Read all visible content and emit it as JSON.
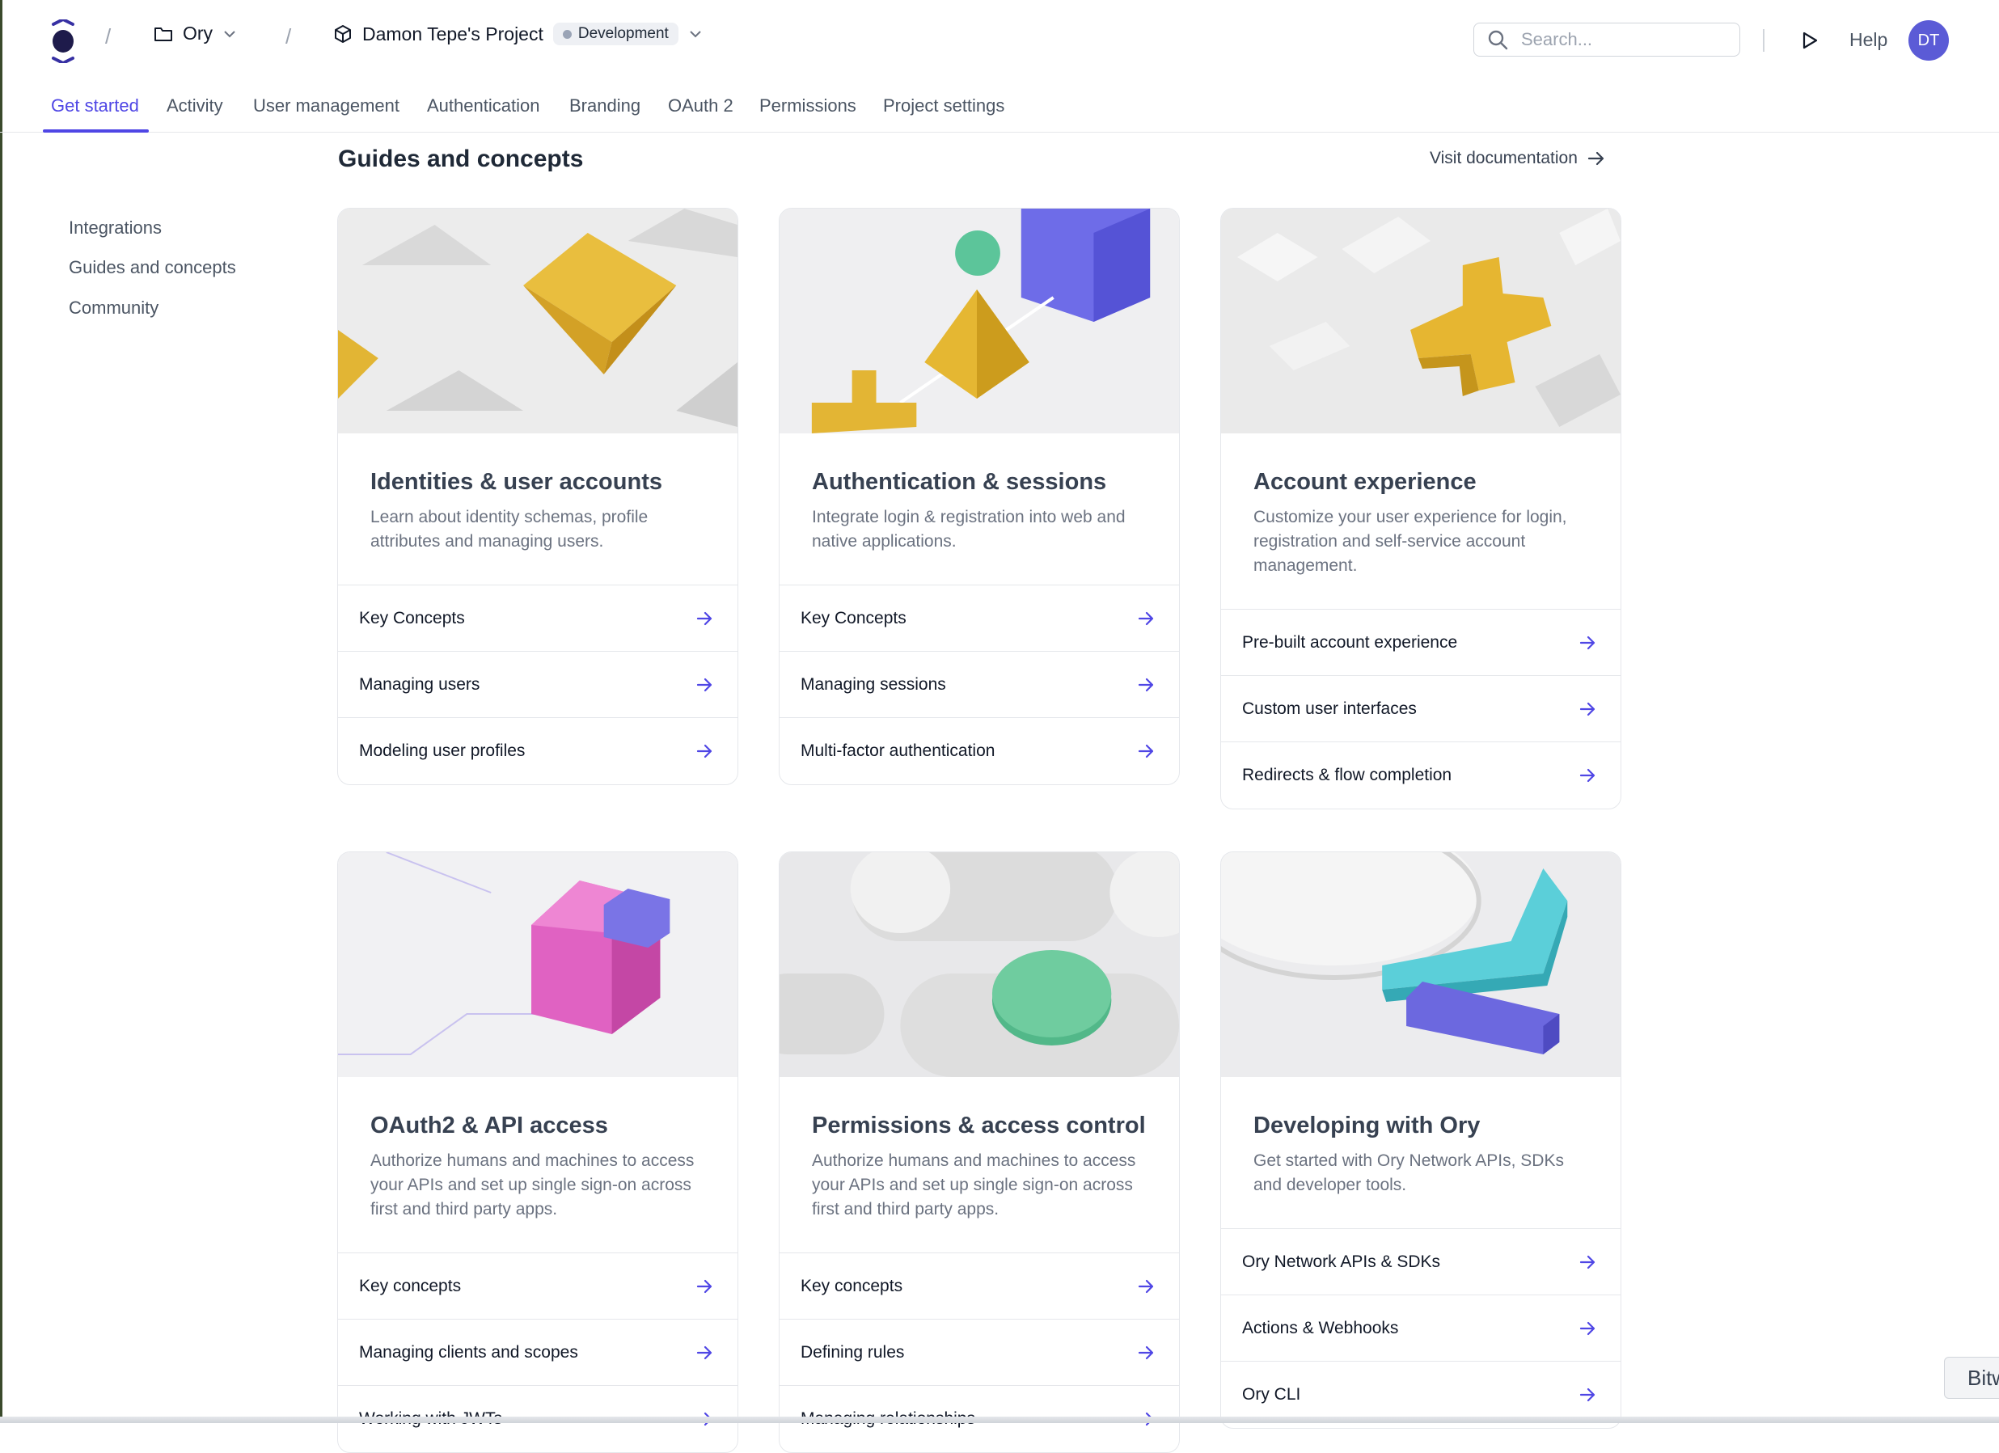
{
  "header": {
    "org_name": "Ory",
    "project_name": "Damon Tepe's Project",
    "environment": "Development",
    "search_placeholder": "Search...",
    "help_label": "Help",
    "avatar_initials": "DT"
  },
  "tabs": [
    {
      "label": "Get started",
      "active": true
    },
    {
      "label": "Activity"
    },
    {
      "label": "User management"
    },
    {
      "label": "Authentication"
    },
    {
      "label": "Branding"
    },
    {
      "label": "OAuth 2"
    },
    {
      "label": "Permissions"
    },
    {
      "label": "Project settings"
    }
  ],
  "sidebar": {
    "items": [
      {
        "label": "Integrations"
      },
      {
        "label": "Guides and concepts"
      },
      {
        "label": "Community"
      }
    ]
  },
  "section": {
    "title": "Guides and concepts",
    "visit_docs_label": "Visit documentation"
  },
  "cards": [
    {
      "title": "Identities & user accounts",
      "description": "Learn about identity schemas, profile attributes and managing users.",
      "links": [
        "Key Concepts",
        "Managing users",
        "Modeling user profiles"
      ]
    },
    {
      "title": "Authentication & sessions",
      "description": "Integrate login & registration into web and native applications.",
      "links": [
        "Key Concepts",
        "Managing sessions",
        "Multi-factor authentication"
      ]
    },
    {
      "title": "Account experience",
      "description": "Customize your user experience for login, registration and self-service account management.",
      "links": [
        "Pre-built account experience",
        "Custom user interfaces",
        "Redirects & flow completion"
      ]
    },
    {
      "title": "OAuth2 & API access",
      "description": "Authorize humans and machines to access your APIs and set up single sign-on across first and third party apps.",
      "links": [
        "Key concepts",
        "Managing clients and scopes",
        "Working with JWTs"
      ]
    },
    {
      "title": "Permissions & access control",
      "description": "Authorize humans and machines to access your APIs and set up single sign-on across first and third party apps.",
      "links": [
        "Key concepts",
        "Defining rules",
        "Managing relationships"
      ]
    },
    {
      "title": "Developing with Ory",
      "description": "Get started with Ory Network APIs, SDKs and developer tools.",
      "links": [
        "Ory Network APIs & SDKs",
        "Actions & Webhooks",
        "Ory CLI"
      ]
    }
  ],
  "extension_badge": "Bitw",
  "colors": {
    "accent": "#4f46e5",
    "avatar": "#5b5bd6",
    "text_primary": "#111827",
    "text_muted": "#6b7280"
  }
}
